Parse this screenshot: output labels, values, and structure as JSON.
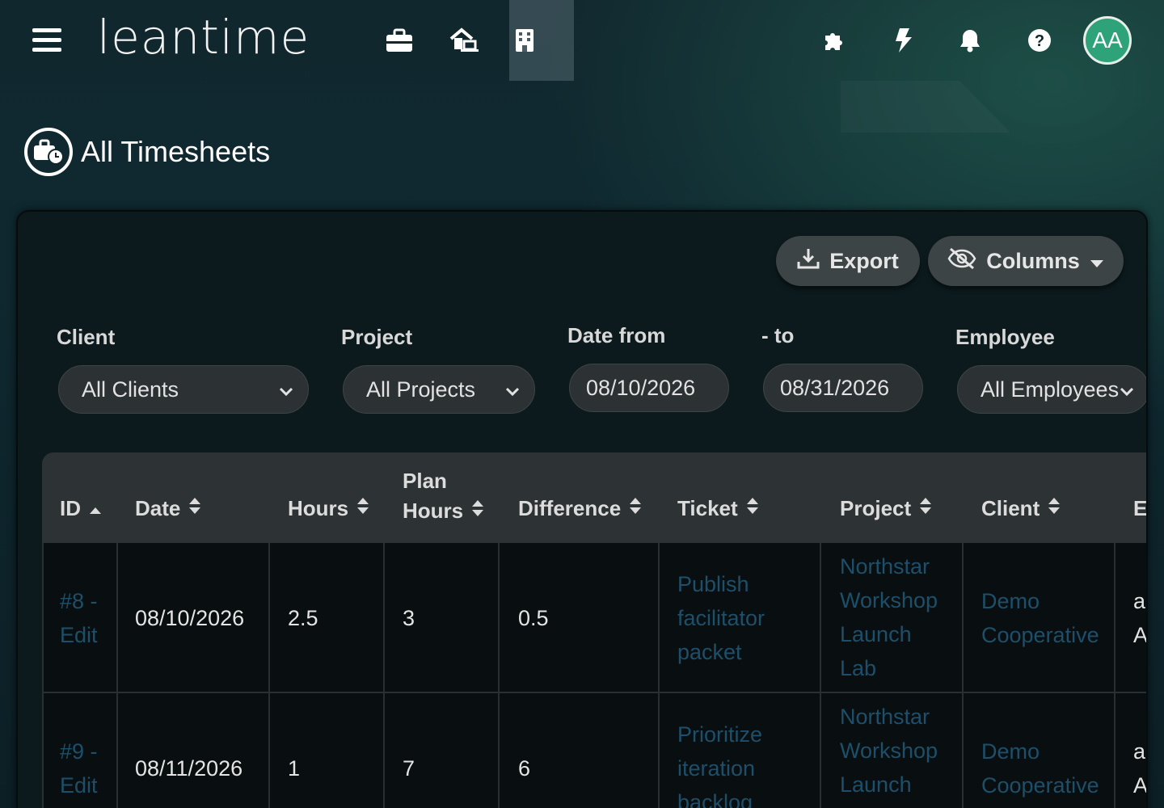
{
  "app": {
    "logo": "leantime"
  },
  "header": {
    "icons": [
      "briefcase-icon",
      "home-laptop-icon",
      "building-icon",
      "puzzle-icon",
      "bolt-icon",
      "bell-icon",
      "help-icon"
    ],
    "avatar_initials": "AA"
  },
  "page": {
    "title": "All Timesheets"
  },
  "toolbar": {
    "export_label": "Export",
    "columns_label": "Columns"
  },
  "filters": {
    "client_label": "Client",
    "client_value": "All Clients",
    "project_label": "Project",
    "project_value": "All Projects",
    "date_from_label": "Date from",
    "date_from_value": "08/10/2026",
    "date_to_label": "- to",
    "date_to_value": "08/31/2026",
    "employee_label": "Employee",
    "employee_value": "All Employees"
  },
  "table": {
    "columns": {
      "id": "ID",
      "date": "Date",
      "hours": "Hours",
      "plan_hours_1": "Plan",
      "plan_hours_2": "Hours",
      "difference": "Difference",
      "ticket": "Ticket",
      "project": "Project",
      "client": "Client",
      "employee": "E"
    },
    "rows": [
      {
        "id_1": "#8 -",
        "id_2": "Edit",
        "date": "08/10/2026",
        "hours": "2.5",
        "plan": "3",
        "diff": "0.5",
        "ticket": [
          "Publish",
          "facilitator",
          "packet"
        ],
        "project": [
          "Northstar",
          "Workshop",
          "Launch",
          "Lab"
        ],
        "client": [
          "Demo",
          "Cooperative"
        ],
        "employee": [
          "ad",
          "A"
        ]
      },
      {
        "id_1": "#9 -",
        "id_2": "Edit",
        "date": "08/11/2026",
        "hours": "1",
        "plan": "7",
        "diff": "6",
        "ticket": [
          "Prioritize",
          "iteration",
          "backlog"
        ],
        "project": [
          "Northstar",
          "Workshop",
          "Launch"
        ],
        "client": [
          "Demo",
          "Cooperative"
        ],
        "employee": [
          "ad",
          "A"
        ]
      }
    ]
  },
  "colors": {
    "accent": "#2ea37a",
    "link": "#1e4f6a",
    "header_bg": "#2d3234"
  }
}
